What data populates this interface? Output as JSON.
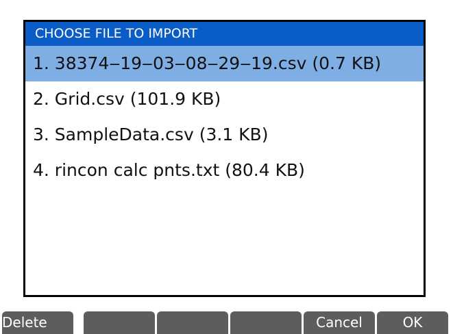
{
  "dialog": {
    "title": "CHOOSE FILE TO IMPORT",
    "files": [
      {
        "label": "1. 38374‒19‒03‒08‒29‒19.csv (0.7 KB)",
        "selected": true
      },
      {
        "label": "2. Grid.csv (101.9 KB)",
        "selected": false
      },
      {
        "label": "3. SampleData.csv (3.1 KB)",
        "selected": false
      },
      {
        "label": "4. rincon calc pnts.txt (80.4 KB)",
        "selected": false
      }
    ]
  },
  "softkeys": [
    "Delete",
    "",
    "",
    "",
    "Cancel",
    "OK"
  ],
  "colors": {
    "title_bar": "#0a5cc7",
    "selection": "#7faee5",
    "softkey": "#5d5d5d"
  }
}
